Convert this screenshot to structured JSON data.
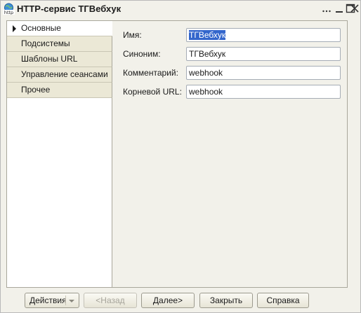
{
  "window": {
    "title": "HTTP-сервис ТГВебхук",
    "icon": "http-globe-icon",
    "icon_label": "http"
  },
  "sidebar": {
    "items": [
      {
        "label": "Основные",
        "active": true
      },
      {
        "label": "Подсистемы",
        "active": false
      },
      {
        "label": "Шаблоны URL",
        "active": false
      },
      {
        "label": "Управление сеансами",
        "active": false
      },
      {
        "label": "Прочее",
        "active": false
      }
    ]
  },
  "form": {
    "name_label": "Имя:",
    "name_value": "ТГВебхук",
    "synonym_label": "Синоним:",
    "synonym_value": "ТГВебхук",
    "comment_label": "Комментарий:",
    "comment_value": "webhook",
    "root_url_label": "Корневой URL:",
    "root_url_value": "webhook"
  },
  "footer": {
    "actions_label": "Действия",
    "back_label": "<Назад",
    "next_label": "Далее>",
    "close_label": "Закрыть",
    "help_label": "Справка"
  },
  "colors": {
    "window_bg": "#f2f1ea",
    "selection": "#3366cc",
    "sidebar_tab": "#ebe8d6"
  }
}
